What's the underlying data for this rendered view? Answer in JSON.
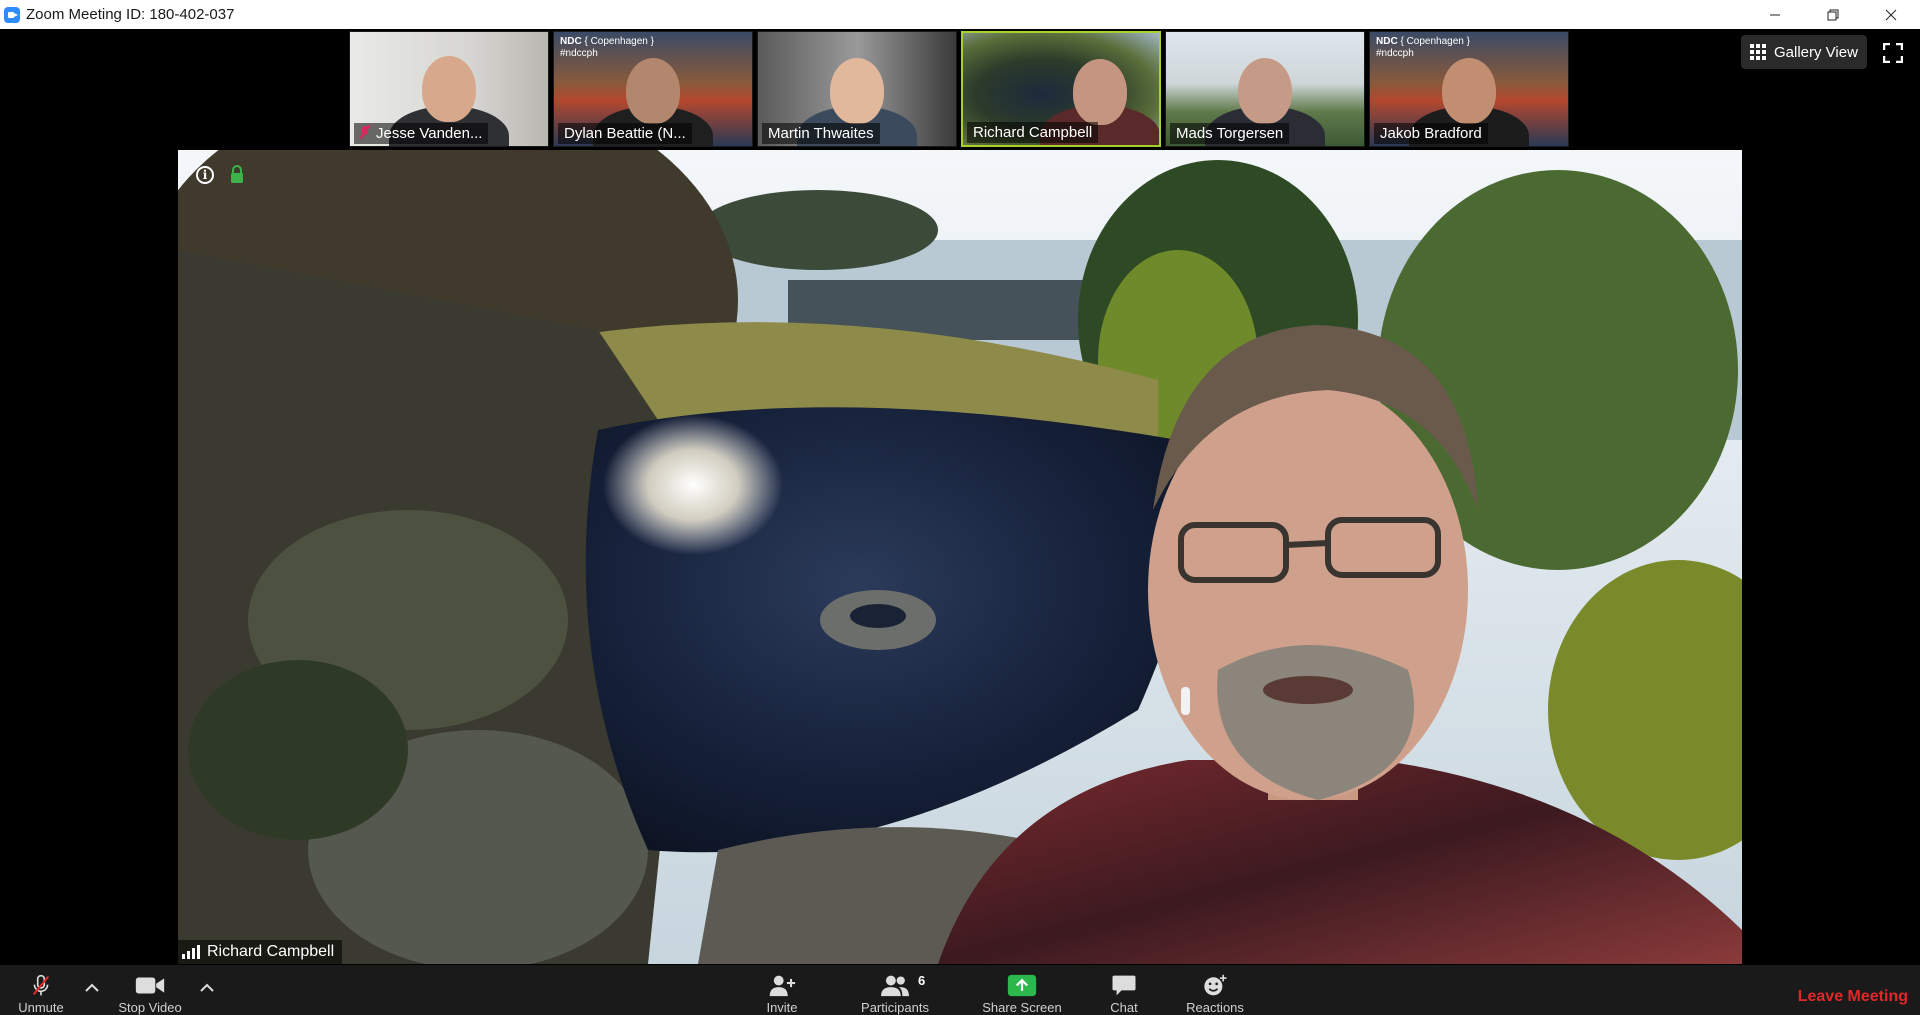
{
  "window": {
    "title": "Zoom Meeting ID: 180-402-037"
  },
  "participants": [
    {
      "name": "Jesse Vanden...",
      "muted": true,
      "background": "office",
      "active": false
    },
    {
      "name": "Dylan Beattie (N...",
      "muted": false,
      "background": "ndc",
      "active": false
    },
    {
      "name": "Martin Thwaites",
      "muted": false,
      "background": "room",
      "active": false
    },
    {
      "name": "Richard Campbell",
      "muted": false,
      "background": "pond",
      "active": true
    },
    {
      "name": "Mads Torgersen",
      "muted": false,
      "background": "garden",
      "active": false
    },
    {
      "name": "Jakob Bradford",
      "muted": false,
      "background": "ndc",
      "active": false
    }
  ],
  "ndc_overlay": {
    "brand": "NDC",
    "city": "{ Copenhagen }",
    "hashtag": "#ndccph"
  },
  "view_controls": {
    "gallery_view_label": "Gallery View"
  },
  "main_video": {
    "speaker_name": "Richard Campbell"
  },
  "toolbar": {
    "mute_label": "Unmute",
    "video_label": "Stop Video",
    "invite_label": "Invite",
    "participants_label": "Participants",
    "participants_count": "6",
    "share_label": "Share Screen",
    "chat_label": "Chat",
    "reactions_label": "Reactions",
    "leave_label": "Leave Meeting"
  },
  "colors": {
    "toolbar_bg": "#1a1a1a",
    "active_border": "#a7d12b",
    "share_green": "#2db84d",
    "leave_red": "#e02828",
    "muted_red": "#e0245e",
    "lock_green": "#3bb34a"
  }
}
